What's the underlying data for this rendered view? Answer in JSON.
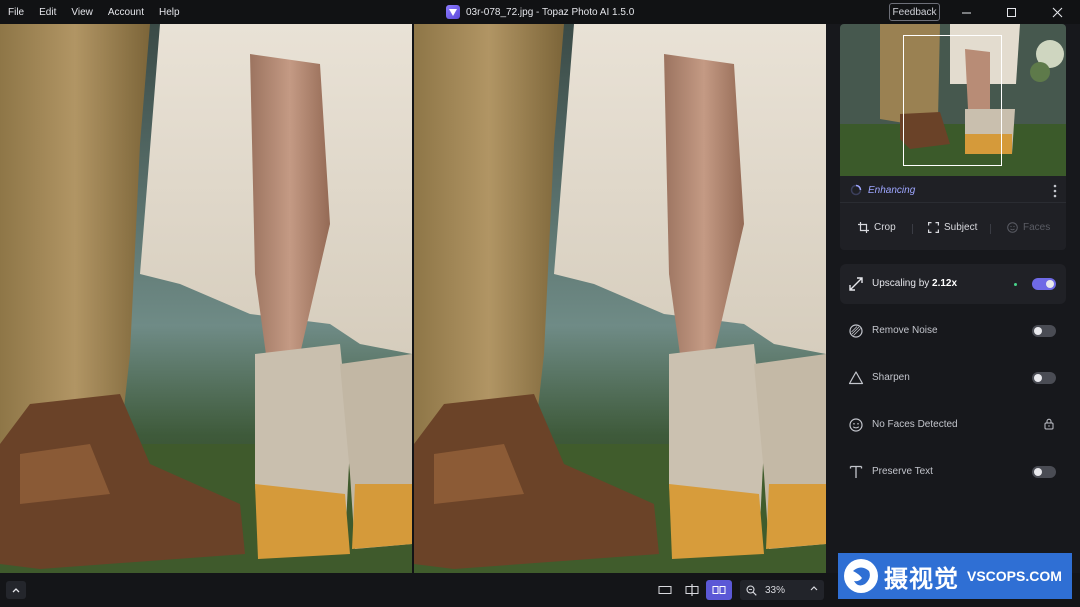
{
  "menu": [
    "File",
    "Edit",
    "View",
    "Account",
    "Help"
  ],
  "window": {
    "title": "03r-078_72.jpg - Topaz Photo AI 1.5.0",
    "feedback_label": "Feedback"
  },
  "navigator": {
    "status": "Enhancing",
    "tools": [
      {
        "label": "Crop",
        "icon": "crop-icon",
        "enabled": true
      },
      {
        "label": "Subject",
        "icon": "subject-select-icon",
        "enabled": true
      },
      {
        "label": "Faces",
        "icon": "face-icon",
        "enabled": false
      }
    ]
  },
  "enhancements": {
    "upscale": {
      "prefix": "Upscaling by ",
      "value": "2.12x",
      "icon": "expand-arrow-icon",
      "enabled": true
    },
    "remove_noise": {
      "label": "Remove Noise",
      "icon": "noise-icon",
      "enabled": false
    },
    "sharpen": {
      "label": "Sharpen",
      "icon": "triangle-icon",
      "enabled": false
    },
    "faces": {
      "label": "No Faces Detected",
      "icon": "face-icon",
      "locked": true
    },
    "preserve_text": {
      "label": "Preserve Text",
      "icon": "text-icon",
      "enabled": false
    }
  },
  "bottom": {
    "zoom": "33%",
    "view_modes": [
      "single-view",
      "split-view",
      "side-by-side-view"
    ],
    "active_view": "side-by-side-view"
  },
  "watermark": {
    "cn": "摄视觉",
    "en": "VSCOPS.COM"
  },
  "colors": {
    "accent": "#6f6ae6",
    "status": "#9ea6ff",
    "watermark": "#2f6fd4"
  }
}
